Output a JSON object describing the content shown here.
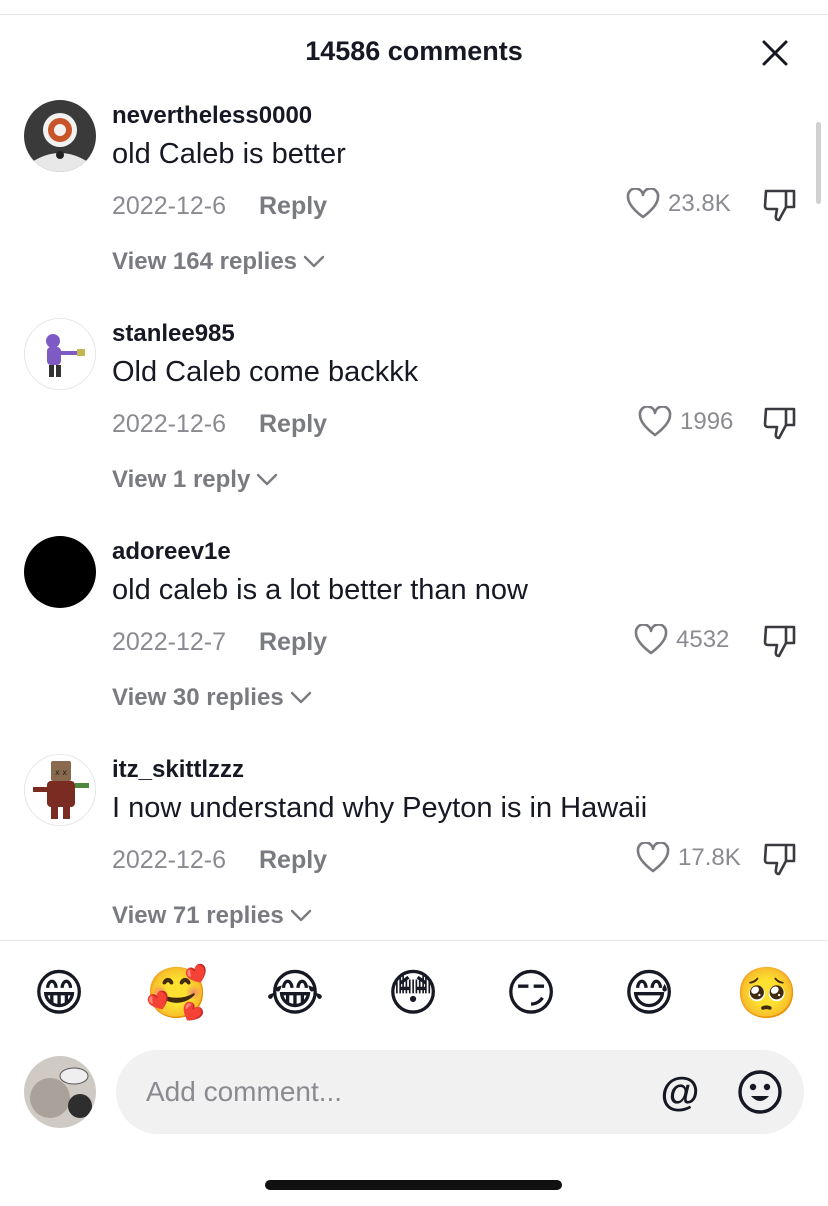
{
  "header": {
    "title": "14586 comments"
  },
  "comments": [
    {
      "username": "nevertheless0000",
      "text": "old Caleb is better",
      "date": "2022-12-6",
      "reply_label": "Reply",
      "likes": "23.8K",
      "view_replies": "View 164 replies"
    },
    {
      "username": "stanlee985",
      "text": "Old Caleb come backkk",
      "date": "2022-12-6",
      "reply_label": "Reply",
      "likes": "1996",
      "view_replies": "View 1 reply"
    },
    {
      "username": "adoreev1e",
      "text": "old caleb is a lot better than now",
      "date": "2022-12-7",
      "reply_label": "Reply",
      "likes": "4532",
      "view_replies": "View 30 replies"
    },
    {
      "username": "itz_skittlzzz",
      "text": "I now understand why Peyton is in Hawaii",
      "date": "2022-12-6",
      "reply_label": "Reply",
      "likes": "17.8K",
      "view_replies": "View 71 replies"
    }
  ],
  "emoji_bar": [
    "😁",
    "🥰",
    "😂",
    "😳",
    "😏",
    "😅",
    "🥺"
  ],
  "input": {
    "placeholder": "Add comment...",
    "mention_symbol": "@"
  },
  "colors": {
    "text": "#161823",
    "secondary": "#8a8b91",
    "input_bg": "#f1f1f2"
  },
  "icons": [
    "close-icon",
    "heart-icon",
    "thumbs-down-icon",
    "chevron-down-icon",
    "emoji-face-icon"
  ]
}
